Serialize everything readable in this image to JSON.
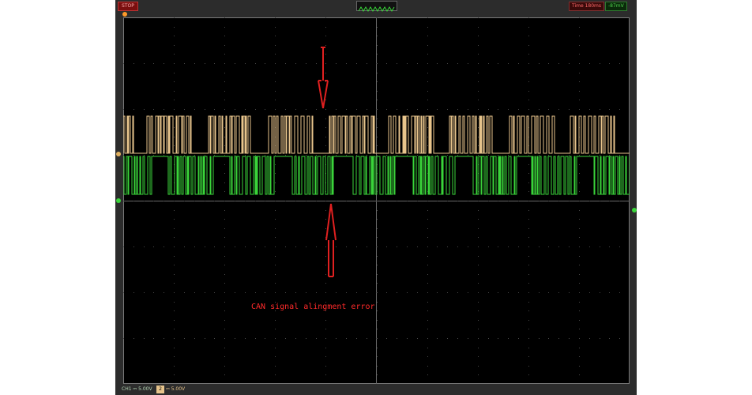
{
  "topbar": {
    "run_state": "STOP",
    "time_readout": "Time 180ms",
    "trigger_readout": "-87mV"
  },
  "bottombar": {
    "ch1_readout": "CH1 ⎓ 5.00V",
    "ch2_tag": "2",
    "ch2_readout": "⎓ 5.00V"
  },
  "annotation": {
    "text": "CAN signal alingment error"
  },
  "colors": {
    "ch1": "#3ad43a",
    "ch2": "#e8c58c",
    "annotation": "#ff2a2a",
    "grid": "#5a5a5a"
  },
  "icons": {
    "ch1_marker": "green-dot-icon",
    "ch2_marker": "orange-dot-icon",
    "down_arrow": "down-arrow-icon",
    "up_arrow": "up-arrow-icon"
  }
}
